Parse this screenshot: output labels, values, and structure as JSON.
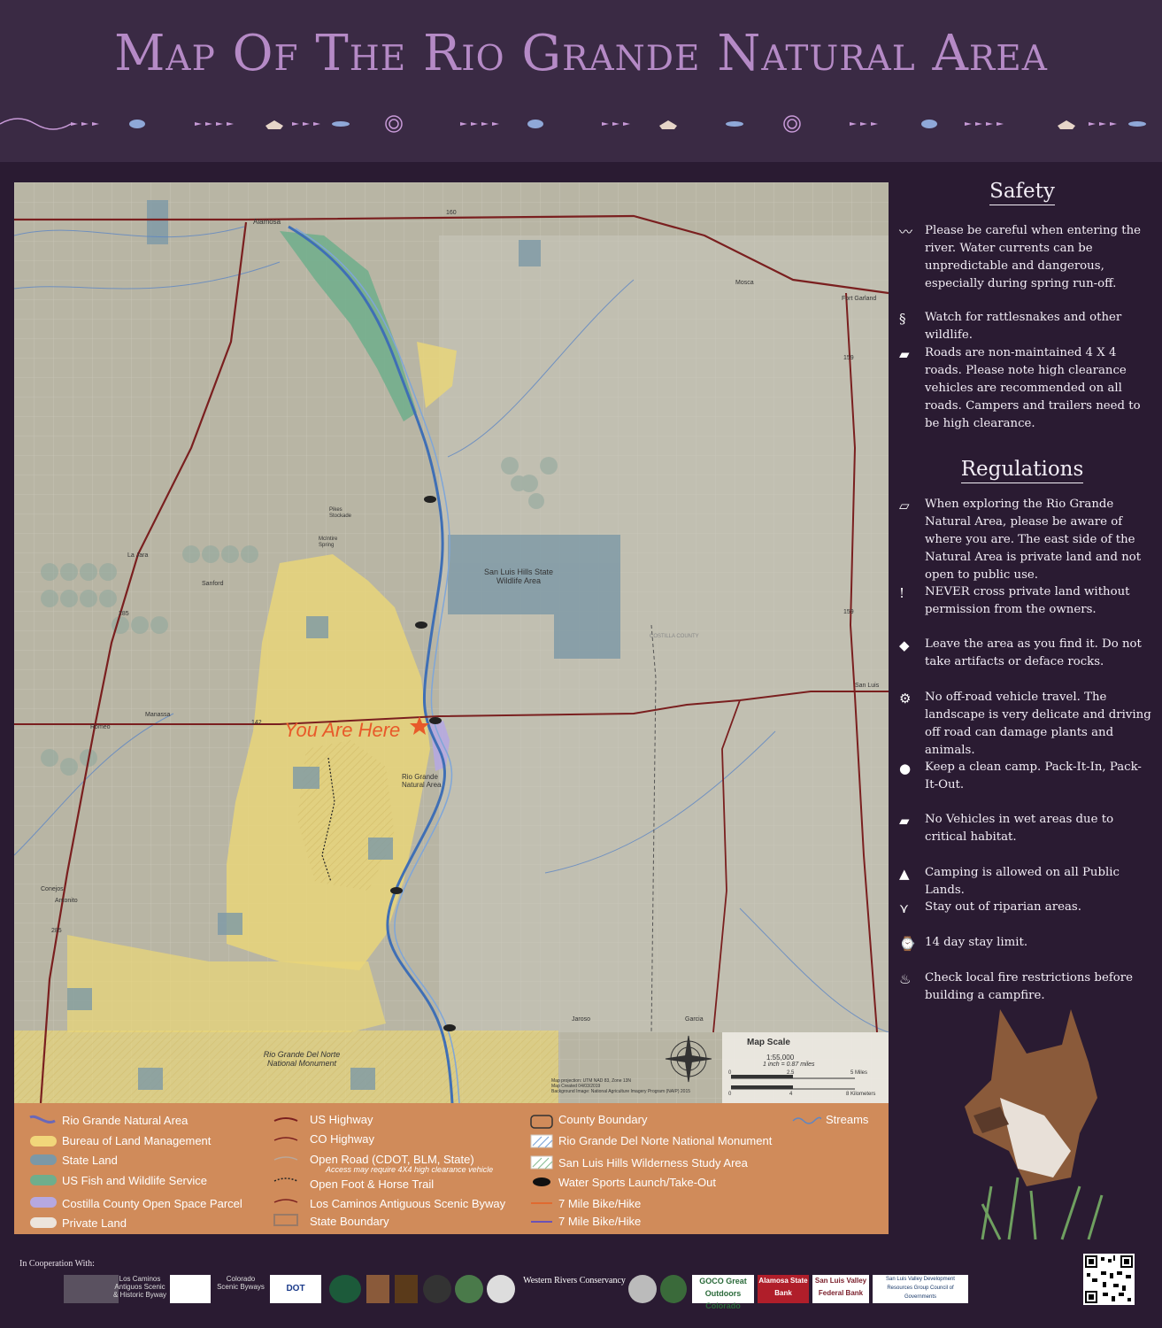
{
  "header": {
    "title": "Map Of The Rio Grande Natural Area"
  },
  "map": {
    "labels": {
      "alamosa": "Alamosa",
      "mosca": "Mosca",
      "fort_garland": "Fort Garland",
      "la_jara": "La Jara",
      "sanford": "Sanford",
      "manassa": "Manassa",
      "romeo": "Romeo",
      "antonito": "Antonito",
      "conejos": "Conejos",
      "san_luis": "San Luis",
      "jaroso": "Jaroso",
      "garcia": "Garcia",
      "pikes_stockade": "Pikes Stockade",
      "mckintire_spring": "McIntire Spring",
      "costilla_county": "COSTILLA COUNTY",
      "slh_swa": "San Luis Hills State Wildlife Area",
      "rgna": "Rio Grande Natural Area",
      "rgdnnm": "Rio Grande Del Norte National Monument",
      "you_are_here": "You Are Here",
      "hwy_160": "160",
      "hwy_285": "285",
      "hwy_285b": "285",
      "hwy_142": "142",
      "hwy_159": "159",
      "hwy_159b": "159"
    },
    "scale": {
      "title": "Map Scale",
      "ratio": "1:55,000",
      "inch": "1 inch = 0.87 miles",
      "miles": "5 Miles",
      "km": "8 Kilometers",
      "t0": "0",
      "t1": "2.5",
      "t2": "0",
      "t3": "4"
    },
    "credits": {
      "line1": "Map projection: UTM NAD 83, Zone 13N",
      "line2": "Map Created 04/03/2019",
      "line3": "Background Image: National Agriculture Imagery Program (NAIP) 2015"
    }
  },
  "legend": {
    "col1": [
      "Rio Grande Natural Area",
      "Bureau of Land Management",
      "State Land",
      "US Fish and Wildlife Service",
      "Costilla County Open Space Parcel",
      "Private Land"
    ],
    "col2": [
      "US Highway",
      "CO Highway",
      "Open Road (CDOT, BLM, State)",
      "Open Foot & Horse Trail",
      "Los Caminos Antiguous Scenic Byway",
      "State Boundary"
    ],
    "col2_sub": "Access may require 4X4 high clearance vehicle",
    "col3": [
      "County Boundary",
      "Rio Grande Del Norte National Monument",
      "San Luis Hills Wilderness Study Area",
      "Water Sports Launch/Take-Out",
      "7 Mile Bike/Hike",
      "7 Mile Bike/Hike"
    ],
    "col4": [
      "Streams"
    ],
    "colors": {
      "rgna": "#6a68b8",
      "blm": "#f1d67a",
      "state": "#7c98a6",
      "usfws": "#6fae8c",
      "costilla": "#b6a8e0",
      "private": "#ece4dc",
      "bike1": "#e06a30",
      "bike2": "#6b52b5"
    }
  },
  "safety": {
    "title": "Safety",
    "items": [
      "Please be careful when entering the river. Water currents can be unpredictable and dangerous, especially during spring run-off.",
      "Watch for rattlesnakes and other wildlife.",
      "Roads are non-maintained 4 X 4 roads. Please note high clearance vehicles are recommended on all roads. Campers and trailers need to be high clearance."
    ]
  },
  "regulations": {
    "title": "Regulations",
    "items": [
      "When exploring the Rio Grande Natural Area, please be aware of where you are. The east side of the Natural Area is private land and not open to public use.",
      "NEVER cross private land without permission from the owners.",
      "Leave the area as you find it. Do not take artifacts or deface rocks.",
      "No off-road vehicle travel. The landscape is very delicate and driving off road can damage plants and animals.",
      "Keep a clean camp. Pack-It-In, Pack-It-Out.",
      "No Vehicles in wet areas due to critical habitat.",
      "Camping is allowed on all Public Lands.",
      "Stay out of riparian areas.",
      "14 day stay limit.",
      "Check local fire restrictions before building a campfire."
    ]
  },
  "footer": {
    "cooperation": "In Cooperation With:",
    "logos": [
      "Los Caminos Antiguos Scenic & Historic Byway",
      "Colorado Scenic Byways",
      "DOT",
      "Western Rivers Conservancy",
      "GOCO Great Outdoors Colorado",
      "Alamosa State Bank",
      "San Luis Valley Federal Bank",
      "San Luis Valley Development Resources Group Council of Governments"
    ]
  }
}
